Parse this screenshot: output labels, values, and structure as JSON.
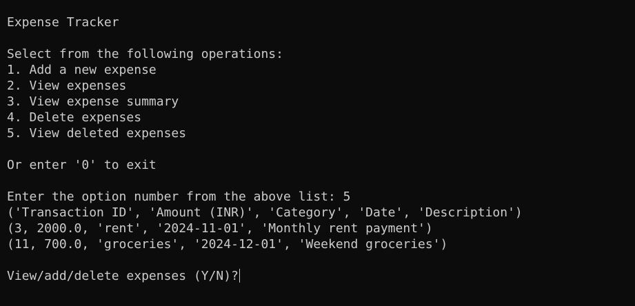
{
  "terminal": {
    "background": "#0c0c0c",
    "foreground": "#cccccc",
    "title_line": "Expense Tracker",
    "menu": {
      "prompt": "Select from the following operations:",
      "options": [
        "1. Add a new expense",
        "2. View expenses",
        "3. View expense summary",
        "4. Delete expenses",
        "5. View deleted expenses"
      ],
      "exit_hint": "Or enter '0' to exit"
    },
    "input_line": "Enter the option number from the above list: 5",
    "output": {
      "header": "('Transaction ID', 'Amount (INR)', 'Category', 'Date', 'Description')",
      "rows": [
        "(3, 2000.0, 'rent', '2024-11-01', 'Monthly rent payment')",
        "(11, 700.0, 'groceries', '2024-12-01', 'Weekend groceries')"
      ]
    },
    "final_prompt": "View/add/delete expenses (Y/N)?"
  }
}
